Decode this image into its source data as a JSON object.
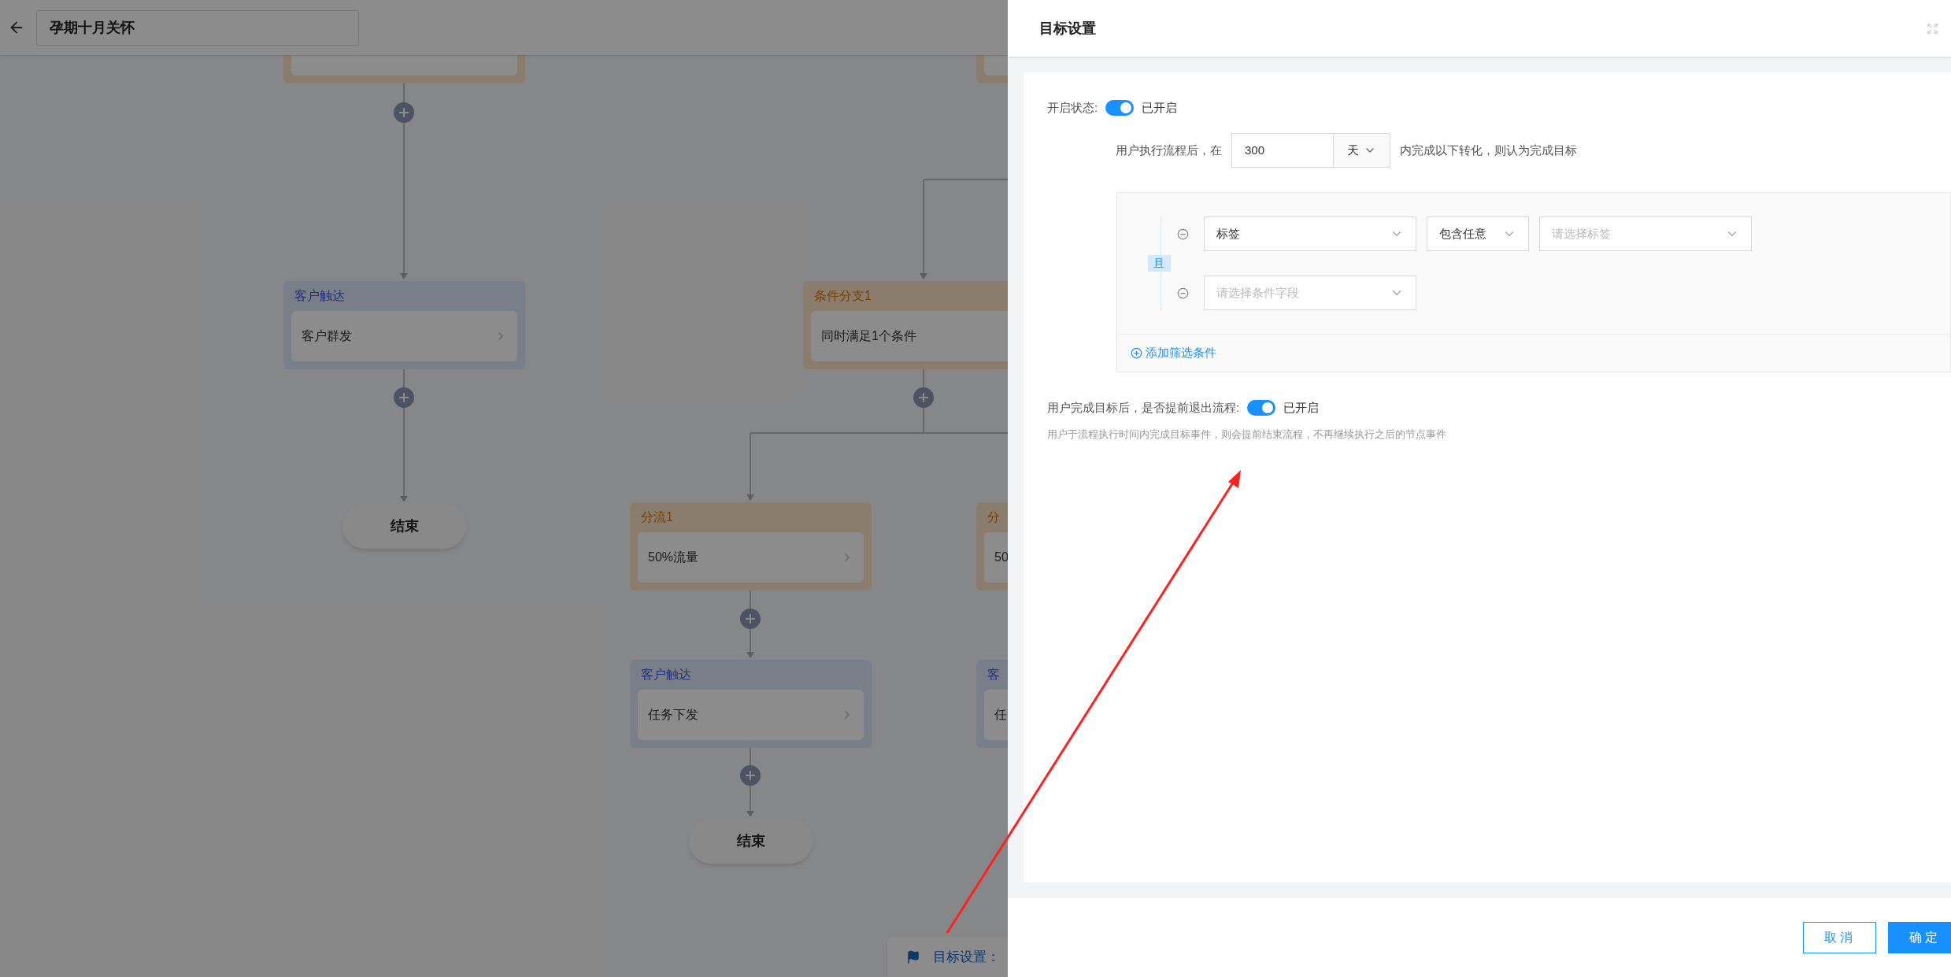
{
  "header": {
    "title": "孕期十月关怀"
  },
  "canvas": {
    "nodes": [
      {
        "kind": "branch"
      },
      {
        "kind": "branch"
      },
      {
        "kind": "reach",
        "title": "客户触达",
        "content": "客户群发"
      },
      {
        "kind": "branch",
        "title": "条件分支1",
        "content": "同时满足1个条件"
      },
      {
        "kind": "branch",
        "title": "分流1",
        "content": "50%流量"
      },
      {
        "kind": "branch",
        "title": "分",
        "content": "50"
      },
      {
        "kind": "reach",
        "title": "客户触达",
        "content": "任务下发"
      },
      {
        "kind": "reach",
        "title": "客",
        "content": "任"
      }
    ],
    "end_nodes": [
      "结束",
      "结束"
    ],
    "goal_bar": {
      "label": "目标设置："
    }
  },
  "panel": {
    "title": "目标设置",
    "status": {
      "label": "开启状态:",
      "on": true,
      "state_text": "已开启"
    },
    "window": {
      "prefix": "用户执行流程后，在",
      "value": "300",
      "unit": "天",
      "suffix": "内完成以下转化，则认为完成目标"
    },
    "conditions": {
      "joiner": "且",
      "rows": [
        {
          "fields": [
            {
              "value": "标签"
            },
            {
              "value": "包含任意"
            },
            {
              "placeholder": "请选择标签"
            }
          ]
        },
        {
          "fields": [
            {
              "placeholder": "请选择条件字段"
            }
          ]
        }
      ],
      "add_label": "添加筛选条件"
    },
    "exit": {
      "label": "用户完成目标后，是否提前退出流程:",
      "on": true,
      "state_text": "已开启",
      "description": "用户于流程执行时间内完成目标事件，则会提前结束流程，不再继续执行之后的节点事件"
    },
    "buttons": [
      {
        "label": "取消",
        "kind": "secondary"
      },
      {
        "label": "确定",
        "kind": "primary"
      }
    ]
  }
}
